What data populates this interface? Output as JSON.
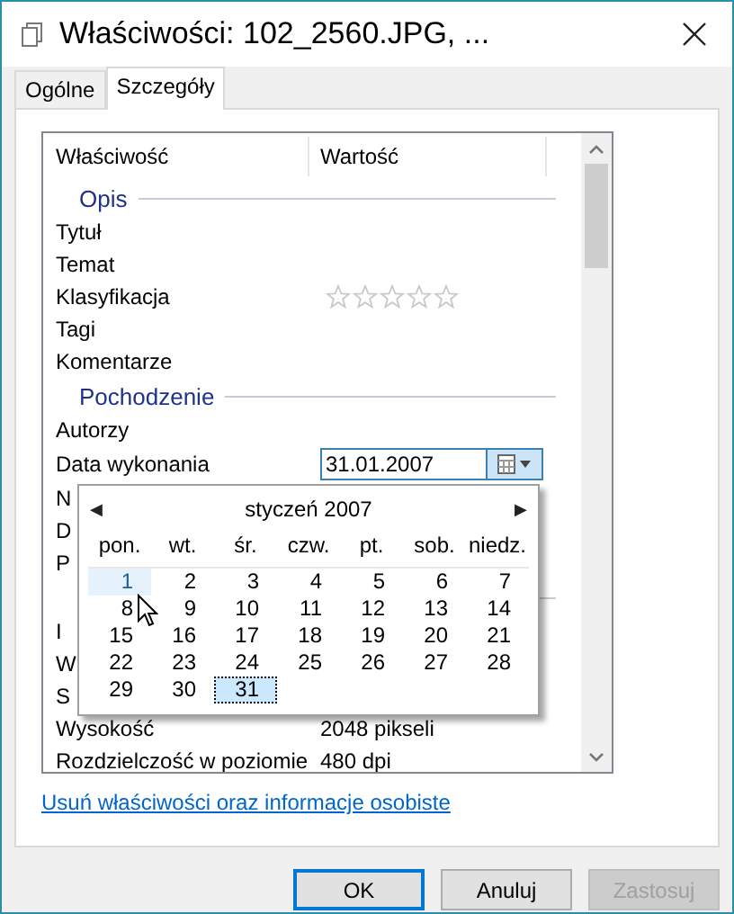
{
  "window": {
    "title": "Właściwości: 102_2560.JPG, ..."
  },
  "tabs": [
    {
      "label": "Ogólne",
      "selected": false
    },
    {
      "label": "Szczegóły",
      "selected": true
    }
  ],
  "properties": {
    "columns": [
      "Właściwość",
      "Wartość"
    ],
    "rows": [
      {
        "kind": "section",
        "title": "Opis"
      },
      {
        "kind": "property",
        "label": "Tytuł"
      },
      {
        "kind": "property",
        "label": "Temat"
      },
      {
        "kind": "rating",
        "label": "Klasyfikacja",
        "stars": 0
      },
      {
        "kind": "property",
        "label": "Tagi"
      },
      {
        "kind": "property",
        "label": "Komentarze"
      },
      {
        "kind": "section",
        "title": "Pochodzenie"
      },
      {
        "kind": "property",
        "label": "Autorzy"
      },
      {
        "kind": "date",
        "label": "Data wykonania",
        "value": "31.01.2007"
      },
      {
        "kind": "property",
        "label": "N"
      },
      {
        "kind": "property",
        "label": "D"
      },
      {
        "kind": "property",
        "label": "P"
      },
      {
        "kind": "section"
      },
      {
        "kind": "property",
        "label": "I"
      },
      {
        "kind": "property",
        "label": "W"
      },
      {
        "kind": "property",
        "label": "S"
      },
      {
        "kind": "property",
        "label": "Wysokość",
        "value": "2048 pikseli"
      },
      {
        "kind": "property",
        "label": "Rozdzielczość w poziomie",
        "value": "480 dpi"
      }
    ]
  },
  "calendar": {
    "prev": "◀",
    "next": "▶",
    "month": "styczeń 2007",
    "weekdays": [
      "pon.",
      "wt.",
      "śr.",
      "czw.",
      "pt.",
      "sob.",
      "niedz."
    ],
    "days": [
      {
        "day": "1",
        "selected": false,
        "hot": true
      },
      {
        "day": "2",
        "selected": false,
        "hot": false
      },
      {
        "day": "3",
        "selected": false,
        "hot": false
      },
      {
        "day": "4",
        "selected": false,
        "hot": false
      },
      {
        "day": "5",
        "selected": false,
        "hot": false
      },
      {
        "day": "6",
        "selected": false,
        "hot": false
      },
      {
        "day": "7",
        "selected": false,
        "hot": false
      },
      {
        "day": "8",
        "selected": false,
        "hot": false
      },
      {
        "day": "9",
        "selected": false,
        "hot": false
      },
      {
        "day": "10",
        "selected": false,
        "hot": false
      },
      {
        "day": "11",
        "selected": false,
        "hot": false
      },
      {
        "day": "12",
        "selected": false,
        "hot": false
      },
      {
        "day": "13",
        "selected": false,
        "hot": false
      },
      {
        "day": "14",
        "selected": false,
        "hot": false
      },
      {
        "day": "15",
        "selected": false,
        "hot": false
      },
      {
        "day": "16",
        "selected": false,
        "hot": false
      },
      {
        "day": "17",
        "selected": false,
        "hot": false
      },
      {
        "day": "18",
        "selected": false,
        "hot": false
      },
      {
        "day": "19",
        "selected": false,
        "hot": false
      },
      {
        "day": "20",
        "selected": false,
        "hot": false
      },
      {
        "day": "21",
        "selected": false,
        "hot": false
      },
      {
        "day": "22",
        "selected": false,
        "hot": false
      },
      {
        "day": "23",
        "selected": false,
        "hot": false
      },
      {
        "day": "24",
        "selected": false,
        "hot": false
      },
      {
        "day": "25",
        "selected": false,
        "hot": false
      },
      {
        "day": "26",
        "selected": false,
        "hot": false
      },
      {
        "day": "27",
        "selected": false,
        "hot": false
      },
      {
        "day": "28",
        "selected": false,
        "hot": false
      },
      {
        "day": "29",
        "selected": false,
        "hot": false
      },
      {
        "day": "30",
        "selected": false,
        "hot": false
      },
      {
        "day": "31",
        "selected": true,
        "hot": false
      }
    ]
  },
  "link": "Usuń właściwości oraz informacje osobiste",
  "buttons": [
    {
      "label": "OK",
      "kind": "default"
    },
    {
      "label": "Anuluj",
      "kind": "normal"
    },
    {
      "label": "Zastosuj",
      "kind": "disabled"
    }
  ]
}
